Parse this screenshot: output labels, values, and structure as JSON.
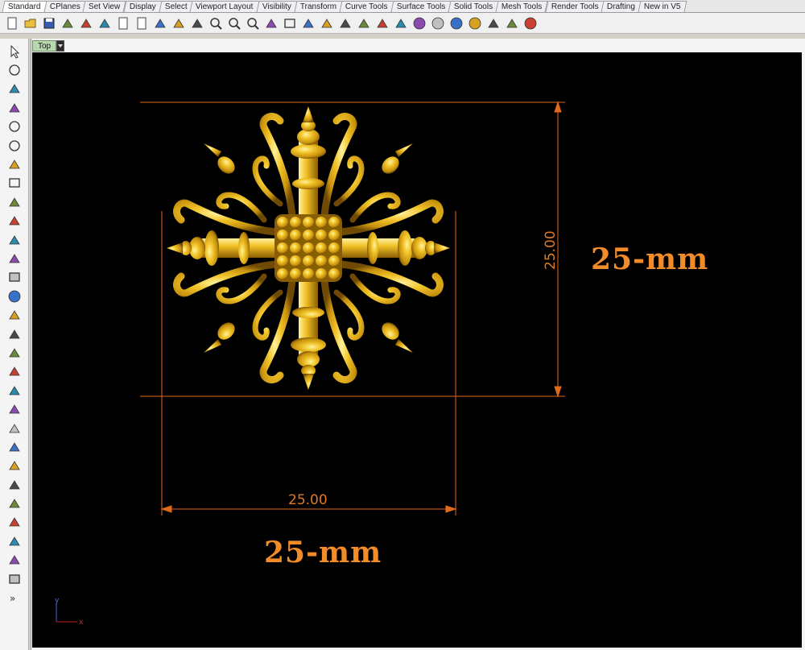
{
  "tabs": [
    "Standard",
    "CPlanes",
    "Set View",
    "Display",
    "Select",
    "Viewport Layout",
    "Visibility",
    "Transform",
    "Curve Tools",
    "Surface Tools",
    "Solid Tools",
    "Mesh Tools",
    "Render Tools",
    "Drafting",
    "New in V5"
  ],
  "active_tab": "Standard",
  "toolbar_icons": [
    "new-file-icon",
    "open-icon",
    "save-icon",
    "print-icon",
    "properties-icon",
    "cut-icon",
    "copy-icon",
    "paste-icon",
    "undo-icon",
    "pan-icon",
    "move-icon",
    "zoom-icon",
    "zoom-window-icon",
    "zoom-extents-icon",
    "rotate-view-icon",
    "viewport-layout-icon",
    "car-icon",
    "layer-icon",
    "clock-icon",
    "text-icon",
    "bulb-icon",
    "paint-icon",
    "color-wheel-icon",
    "sphere-shaded-icon",
    "sphere-rendered-icon",
    "globe-icon",
    "light-icon",
    "snap-icon",
    "help-icon"
  ],
  "left_toolbar_icons": [
    "select-arrow-icon",
    "point-icon",
    "polyline-icon",
    "curve-icon",
    "circle-icon",
    "ellipse-icon",
    "arc-icon",
    "rectangle-icon",
    "polygon-icon",
    "fillet-icon",
    "surface-icon",
    "extrude-icon",
    "box-icon",
    "sphere-icon",
    "cylinder-icon",
    "mesh-icon",
    "gear-icon",
    "explode-icon",
    "trim-icon",
    "split-icon",
    "boolean-icon",
    "group-icon",
    "rotate-icon",
    "curve-edit-icon",
    "text-tool-icon",
    "dimension-icon",
    "block-icon",
    "edit-icon",
    "render-box-icon",
    "more-icon"
  ],
  "viewport": {
    "name": "Top",
    "axis_y": "y",
    "axis_x": "x"
  },
  "dimensions": {
    "horizontal": "25.00",
    "vertical": "25.00"
  },
  "labels": {
    "right": "25-mm",
    "bottom": "25-mm"
  },
  "colors": {
    "dimension_line": "#e06a1a",
    "label": "#f28c28",
    "gold": "#e8b21a",
    "background": "#000000"
  }
}
